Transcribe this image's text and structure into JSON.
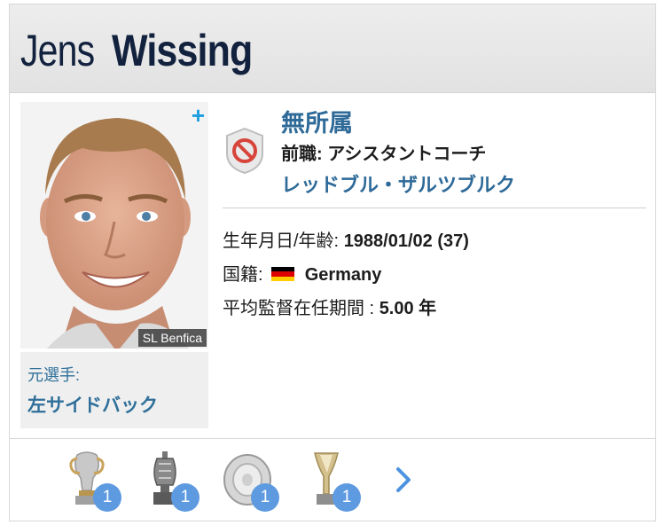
{
  "header": {
    "first_name": "Jens",
    "last_name": "Wissing"
  },
  "photo": {
    "club_tag": "SL Benfica",
    "plus_label": "+"
  },
  "former": {
    "label": "元選手:",
    "position": "左サイドバック"
  },
  "status": {
    "title": "無所属",
    "prev_role_label": "前職:",
    "prev_role_value": "アシスタントコーチ",
    "prev_club": "レッドブル・ザルツブルク",
    "icon": "no-entry-icon"
  },
  "info": {
    "birth_label": "生年月日/年齢:",
    "birth_value": "1988/01/02 (37)",
    "nationality_label": "国籍:",
    "nationality_value": "Germany",
    "tenure_label": "平均監督在任期間 :",
    "tenure_value": "5.00 年"
  },
  "trophies": [
    {
      "icon": "trophy-cup-icon",
      "count": "1"
    },
    {
      "icon": "trophy-urn-icon",
      "count": "1"
    },
    {
      "icon": "trophy-plate-icon",
      "count": "1"
    },
    {
      "icon": "trophy-tall-icon",
      "count": "1"
    }
  ],
  "colors": {
    "accent_blue": "#2e6a98",
    "badge_blue": "#5d9ae0",
    "header_bg": "#e6e6e6",
    "flag": [
      "#000000",
      "#dd0000",
      "#ffce00"
    ]
  }
}
